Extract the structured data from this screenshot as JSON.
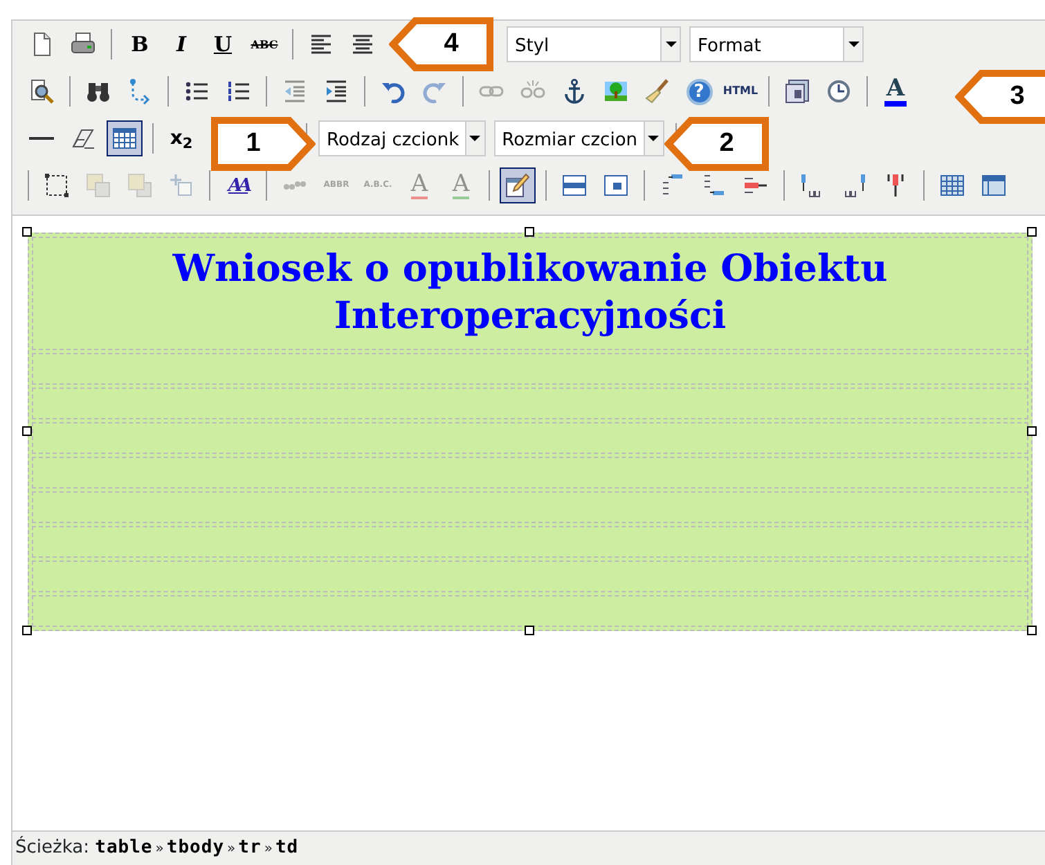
{
  "toolbars": [
    {
      "items": [
        {
          "kind": "newdoc",
          "disabled": false,
          "selected": false
        },
        {
          "kind": "print",
          "disabled": false,
          "selected": false
        },
        {
          "kind": "separator"
        },
        {
          "kind": "bold",
          "label": "B",
          "disabled": false,
          "selected": false
        },
        {
          "kind": "italic",
          "label": "I",
          "disabled": false,
          "selected": false
        },
        {
          "kind": "underline",
          "label": "U",
          "disabled": false,
          "selected": false
        },
        {
          "kind": "strike",
          "label": "ABC",
          "disabled": false,
          "selected": false
        },
        {
          "kind": "separator"
        },
        {
          "kind": "alignleft",
          "disabled": false,
          "selected": false
        },
        {
          "kind": "aligncenter",
          "disabled": false,
          "selected": false
        },
        {
          "kind": "gap"
        },
        {
          "kind": "select",
          "value": "Styl"
        },
        {
          "kind": "select",
          "value": "Format"
        }
      ]
    },
    {
      "items": [
        {
          "kind": "preview",
          "disabled": false,
          "selected": false
        },
        {
          "kind": "separator"
        },
        {
          "kind": "find",
          "disabled": false,
          "selected": false
        },
        {
          "kind": "replace",
          "disabled": false,
          "selected": false
        },
        {
          "kind": "separator"
        },
        {
          "kind": "bullist",
          "disabled": false,
          "selected": false
        },
        {
          "kind": "numlist",
          "disabled": false,
          "selected": false
        },
        {
          "kind": "separator"
        },
        {
          "kind": "outdent",
          "disabled": true,
          "selected": false
        },
        {
          "kind": "indent",
          "disabled": false,
          "selected": false
        },
        {
          "kind": "separator"
        },
        {
          "kind": "undo",
          "disabled": false,
          "selected": false
        },
        {
          "kind": "redo",
          "disabled": true,
          "selected": false
        },
        {
          "kind": "separator"
        },
        {
          "kind": "link",
          "disabled": true,
          "selected": false
        },
        {
          "kind": "unlink",
          "disabled": true,
          "selected": false
        },
        {
          "kind": "anchor",
          "disabled": false,
          "selected": false
        },
        {
          "kind": "image",
          "disabled": false,
          "selected": false
        },
        {
          "kind": "cleanup",
          "disabled": false,
          "selected": false
        },
        {
          "kind": "help",
          "label": "?",
          "disabled": false,
          "selected": false
        },
        {
          "kind": "code",
          "label": "HTML",
          "disabled": false,
          "selected": false
        },
        {
          "kind": "separator"
        },
        {
          "kind": "insertdate",
          "disabled": false,
          "selected": false
        },
        {
          "kind": "inserttime",
          "disabled": false,
          "selected": false
        },
        {
          "kind": "separator"
        },
        {
          "kind": "forecolor",
          "label": "A",
          "disabled": false,
          "selected": false
        }
      ]
    },
    {
      "items": [
        {
          "kind": "hr",
          "disabled": false,
          "selected": false
        },
        {
          "kind": "removeformat",
          "disabled": false,
          "selected": false
        },
        {
          "kind": "table",
          "disabled": false,
          "selected": true
        },
        {
          "kind": "separator"
        },
        {
          "kind": "sub",
          "label": "x$_{2}$",
          "disabled": false,
          "selected": false
        },
        {
          "kind": "gap"
        },
        {
          "kind": "separator"
        },
        {
          "kind": "select",
          "value": "Rodzaj czcionk"
        },
        {
          "kind": "select",
          "value": "Rozmiar czcion"
        },
        {
          "kind": "separator"
        }
      ]
    },
    {
      "items": [
        {
          "kind": "separator"
        },
        {
          "kind": "layer",
          "disabled": false,
          "selected": false
        },
        {
          "kind": "forward",
          "disabled": true,
          "selected": false
        },
        {
          "kind": "backward",
          "disabled": true,
          "selected": false
        },
        {
          "kind": "absolute",
          "disabled": true,
          "selected": false
        },
        {
          "kind": "separator"
        },
        {
          "kind": "styleprops",
          "label": "AA",
          "disabled": false,
          "selected": false
        },
        {
          "kind": "separator"
        },
        {
          "kind": "cite",
          "disabled": true,
          "selected": false
        },
        {
          "kind": "abbr",
          "label": "ABBR",
          "disabled": true,
          "selected": false
        },
        {
          "kind": "acronym",
          "label": "A.B.C.",
          "disabled": true,
          "selected": false
        },
        {
          "kind": "del",
          "label": "A",
          "disabled": true,
          "selected": false
        },
        {
          "kind": "ins",
          "label": "A",
          "disabled": true,
          "selected": false
        },
        {
          "kind": "separator"
        },
        {
          "kind": "attribs",
          "disabled": false,
          "selected": true
        },
        {
          "kind": "separator"
        },
        {
          "kind": "rowprops",
          "disabled": false,
          "selected": false
        },
        {
          "kind": "cellprops",
          "disabled": false,
          "selected": false
        },
        {
          "kind": "separator"
        },
        {
          "kind": "rowbefore",
          "disabled": false,
          "selected": false
        },
        {
          "kind": "rowafter",
          "disabled": false,
          "selected": false
        },
        {
          "kind": "deleterow",
          "disabled": false,
          "selected": false
        },
        {
          "kind": "separator"
        },
        {
          "kind": "colbefore",
          "disabled": false,
          "selected": false
        },
        {
          "kind": "colafter",
          "disabled": false,
          "selected": false
        },
        {
          "kind": "deletecol",
          "disabled": false,
          "selected": false
        },
        {
          "kind": "separator"
        },
        {
          "kind": "tablegrid",
          "disabled": false,
          "selected": false
        },
        {
          "kind": "mergecells",
          "disabled": false,
          "selected": false
        }
      ]
    }
  ],
  "content": {
    "rows": [
      {
        "text": "Wniosek o opublikowanie Obiektu Interoperacyjności"
      },
      {
        "text": ""
      },
      {
        "text": ""
      },
      {
        "text": ""
      },
      {
        "text": ""
      },
      {
        "text": ""
      },
      {
        "text": ""
      },
      {
        "text": ""
      },
      {
        "text": ""
      }
    ]
  },
  "status_bar": {
    "label": "Ścieżka:",
    "path": [
      {
        "label": "table"
      },
      {
        "sep": "»",
        "label": "tbody"
      },
      {
        "sep": "»",
        "label": "tr"
      },
      {
        "sep": "»",
        "label": "td"
      }
    ]
  },
  "callouts": [
    {
      "label": "1"
    },
    {
      "label": "2"
    },
    {
      "label": "3"
    },
    {
      "label": "4"
    }
  ]
}
